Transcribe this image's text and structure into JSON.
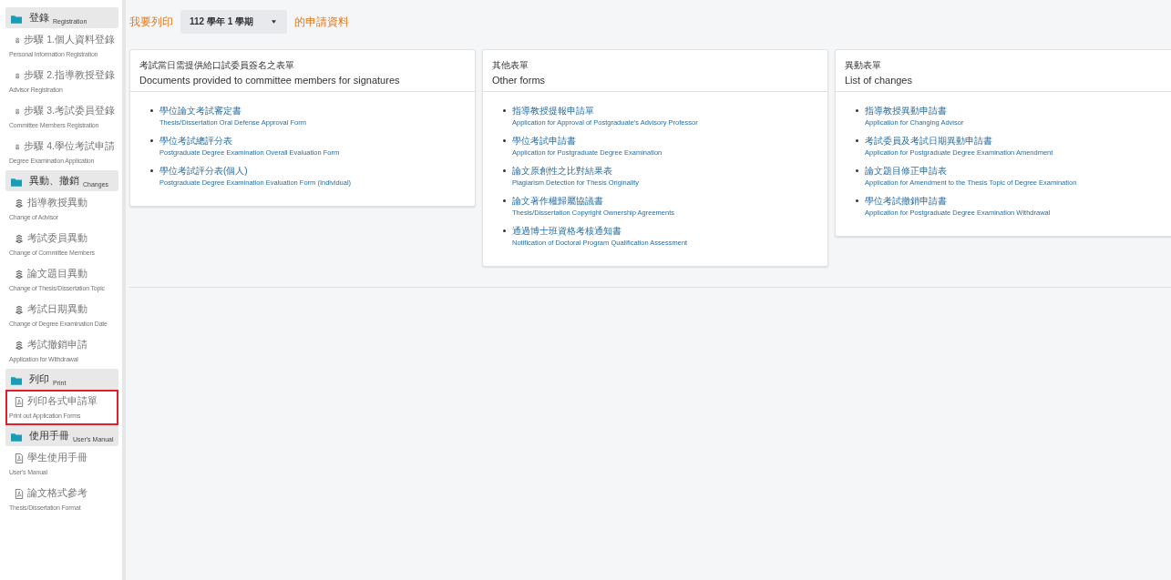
{
  "sidebar": {
    "sections": [
      {
        "title": "登錄",
        "subtitle": "Registration",
        "items": [
          {
            "kind": "step",
            "label": "步驟 1.個人資料登錄",
            "sublabel": "Personal Information Registration",
            "highlighted": false
          },
          {
            "kind": "step",
            "label": "步驟 2.指導教授登錄",
            "sublabel": "Advisor Registration",
            "highlighted": false
          },
          {
            "kind": "step",
            "label": "步驟 3.考試委員登錄",
            "sublabel": "Committee Members Registration",
            "highlighted": false
          },
          {
            "kind": "step",
            "label": "步驟 4.學位考試申請",
            "sublabel": "Degree Examination Application",
            "highlighted": false
          }
        ]
      },
      {
        "title": "異動、撤銷",
        "subtitle": "Changes",
        "items": [
          {
            "kind": "step",
            "label": "指導教授異動",
            "sublabel": "Change of Advisor",
            "highlighted": false
          },
          {
            "kind": "step",
            "label": "考試委員異動",
            "sublabel": "Change of Committee Members",
            "highlighted": false
          },
          {
            "kind": "step",
            "label": "論文題目異動",
            "sublabel": "Change of Thesis/Dissertation Topic",
            "highlighted": false
          },
          {
            "kind": "step",
            "label": "考試日期異動",
            "sublabel": "Change of Degree Examination Date",
            "highlighted": false
          },
          {
            "kind": "step",
            "label": "考試撤銷申請",
            "sublabel": "Application for Withdrawal",
            "highlighted": false
          }
        ]
      },
      {
        "title": "列印",
        "subtitle": "Print",
        "items": [
          {
            "kind": "pdf",
            "label": "列印各式申請單",
            "sublabel": "Print out Application Forms",
            "highlighted": true
          }
        ]
      },
      {
        "title": "使用手冊",
        "subtitle": "User's Manual",
        "items": [
          {
            "kind": "pdf",
            "label": "學生使用手冊",
            "sublabel": "User's Manual",
            "highlighted": false
          },
          {
            "kind": "pdf",
            "label": "論文格式參考",
            "sublabel": "Thesis/Dissertation Format",
            "highlighted": false
          }
        ]
      }
    ]
  },
  "header": {
    "prefix": "我要列印",
    "semester": "112 學年 1 學期",
    "suffix": "的申請資料"
  },
  "cards": [
    {
      "title": "考試當日需提供給口試委員簽名之表單",
      "subtitle": "Documents provided to committee members for signatures",
      "links": [
        {
          "label": "學位論文考試審定書",
          "sublabel": "Thesis/Dissertation Oral Defense Approval Form"
        },
        {
          "label": "學位考試總評分表",
          "sublabel": "Postgraduate Degree Examination Overall Evaluation Form"
        },
        {
          "label": "學位考試評分表(個人)",
          "sublabel": "Postgraduate Degree Examination Evaluation Form (Individual)"
        }
      ]
    },
    {
      "title": "其他表單",
      "subtitle": "Other forms",
      "links": [
        {
          "label": "指導教授提報申請單",
          "sublabel": "Application for Approval of Postgraduate's Advisory Professor"
        },
        {
          "label": "學位考試申請書",
          "sublabel": "Application for Postgraduate Degree Examination"
        },
        {
          "label": "論文原創性之比對結果表",
          "sublabel": "Plagiarism Detection for Thesis Originality"
        },
        {
          "label": "論文著作權歸屬協議書",
          "sublabel": "Thesis/Dissertation Copyright Ownership Agreements"
        },
        {
          "label": "通過博士班資格考核通知書",
          "sublabel": "Notification of Doctoral Program Qualification Assessment"
        }
      ]
    },
    {
      "title": "異動表單",
      "subtitle": "List of changes",
      "links": [
        {
          "label": "指導教授異動申請書",
          "sublabel": "Application for Changing Advisor"
        },
        {
          "label": "考試委員及考試日期異動申請書",
          "sublabel": "Application for Postgraduate Degree Examination Amendment"
        },
        {
          "label": "論文題目修正申請表",
          "sublabel": "Application for Amendment to the Thesis Topic of Degree Examination"
        },
        {
          "label": "學位考試撤銷申請書",
          "sublabel": "Application for Postgraduate Degree Examination Withdrawal"
        }
      ]
    }
  ]
}
